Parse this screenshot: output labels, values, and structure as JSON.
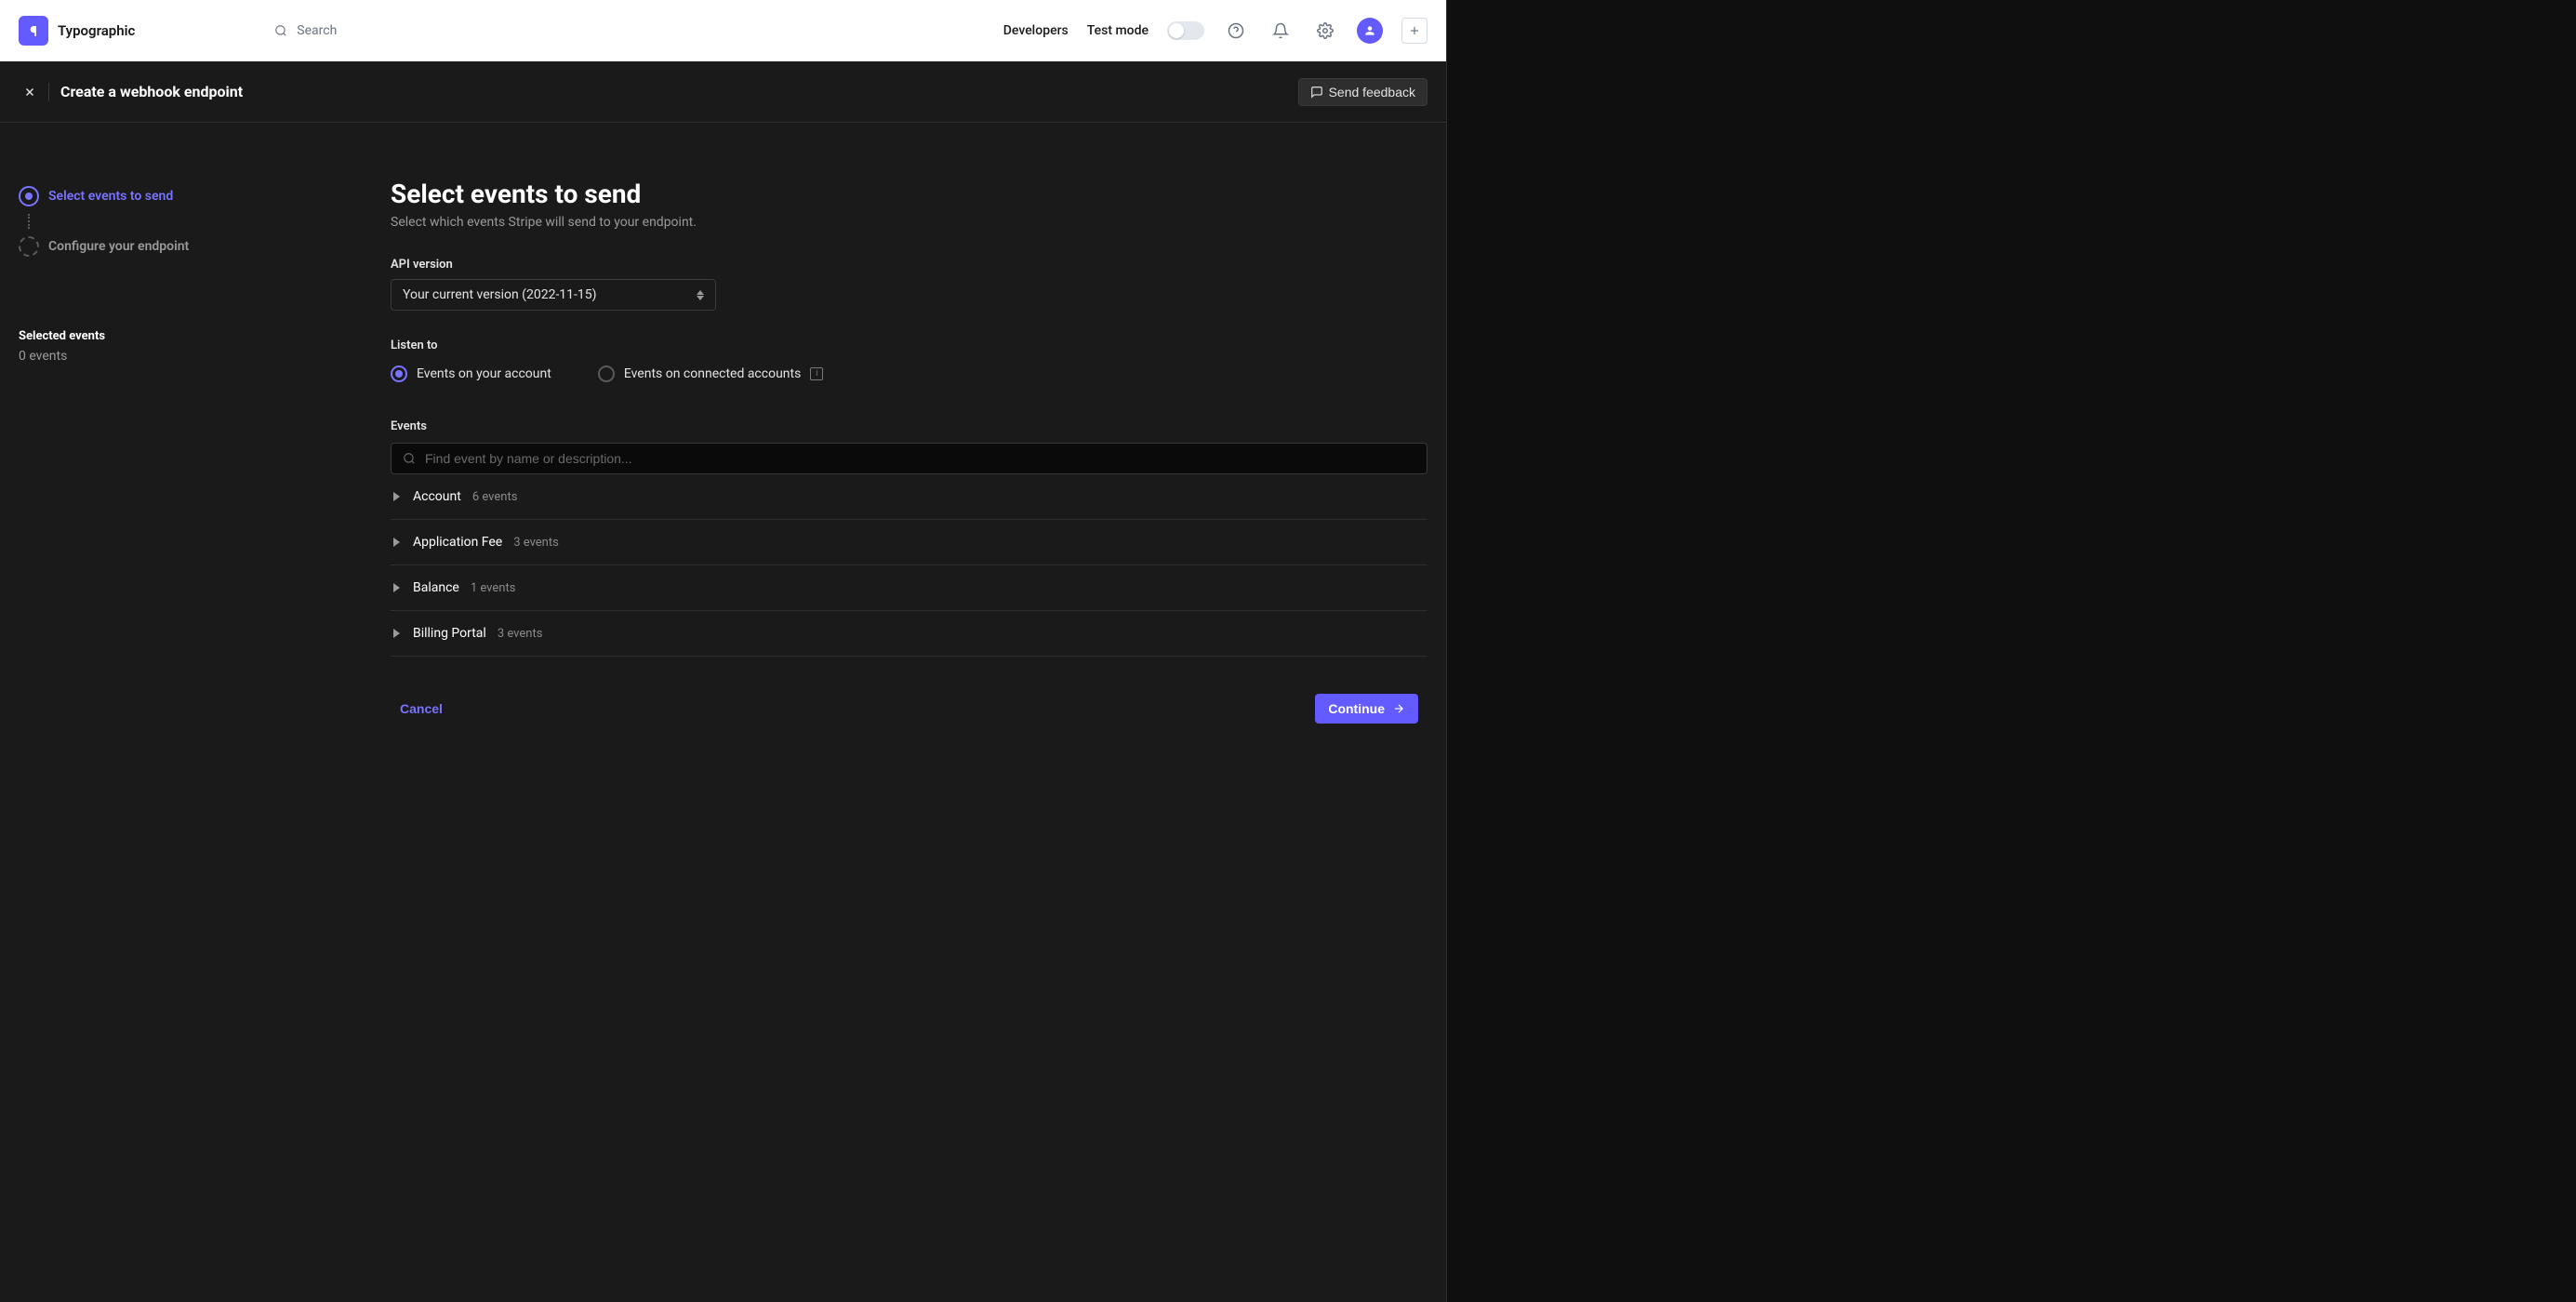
{
  "topbar": {
    "app_name": "Typographic",
    "search_placeholder": "Search",
    "developers_link": "Developers",
    "test_mode_label": "Test mode"
  },
  "header": {
    "title": "Create a webhook endpoint",
    "feedback_label": "Send feedback"
  },
  "sidebar": {
    "steps": [
      {
        "label": "Select events to send",
        "active": true
      },
      {
        "label": "Configure your endpoint",
        "active": false
      }
    ],
    "selected_label": "Selected events",
    "selected_count": "0 events"
  },
  "main": {
    "title": "Select events to send",
    "subtitle": "Select which events Stripe will send to your endpoint.",
    "api_version_label": "API version",
    "api_version_value": "Your current version (2022-11-15)",
    "listen_to_label": "Listen to",
    "radio_options": [
      {
        "label": "Events on your account",
        "selected": true
      },
      {
        "label": "Events on connected accounts",
        "selected": false
      }
    ],
    "events_label": "Events",
    "events_search_placeholder": "Find event by name or description...",
    "event_categories": [
      {
        "name": "Account",
        "count": "6 events"
      },
      {
        "name": "Application Fee",
        "count": "3 events"
      },
      {
        "name": "Balance",
        "count": "1 events"
      },
      {
        "name": "Billing Portal",
        "count": "3 events"
      }
    ],
    "cancel_label": "Cancel",
    "continue_label": "Continue"
  }
}
